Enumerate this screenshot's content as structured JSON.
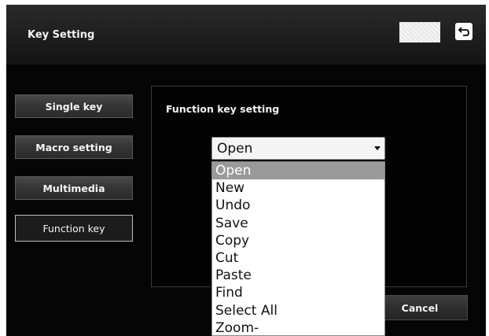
{
  "window": {
    "title": "Key Setting"
  },
  "sidebar": {
    "items": [
      {
        "label": "Single key",
        "active": false
      },
      {
        "label": "Macro setting",
        "active": false
      },
      {
        "label": "Multimedia",
        "active": false
      },
      {
        "label": "Function key",
        "active": true
      }
    ]
  },
  "panel": {
    "title": "Function key setting"
  },
  "select": {
    "selected": "Open",
    "options": [
      "Open",
      "New",
      "Undo",
      "Save",
      "Copy",
      "Cut",
      "Paste",
      "Find",
      "Select All",
      "Zoom-"
    ],
    "highlighted_index": 0
  },
  "footer": {
    "cancel_label": "Cancel"
  },
  "icons": {
    "back": "return-arrow-icon"
  },
  "colors": {
    "background": "#000000",
    "button_top": "#4a4a4a",
    "active_border": "#bdbdbd",
    "highlight": "#9a9a9a"
  }
}
